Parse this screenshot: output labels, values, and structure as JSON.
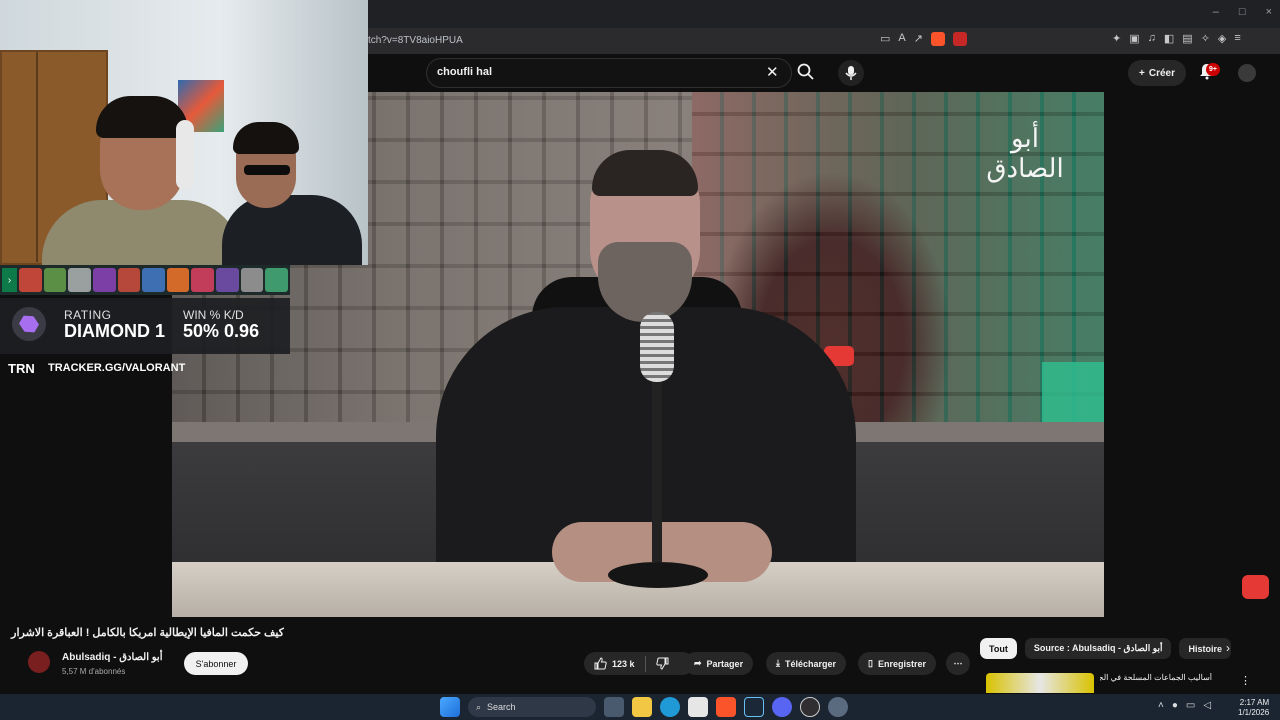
{
  "browser": {
    "url": "tch?v=8TV8aioHPUA",
    "window_controls": [
      "–",
      "□",
      "×"
    ]
  },
  "youtube_header": {
    "search_query": "choufli hal",
    "create_label": "Créer",
    "notification_badge": "9+"
  },
  "video": {
    "channel_logo_text": "أبو الصادق"
  },
  "overlay": {
    "rating_label": "RATING",
    "rating_value": "DIAMOND 1",
    "win_label": "WIN %",
    "kd_label": "K/D",
    "win_value": "50%",
    "kd_value": "0.96",
    "trn_logo": "TRN",
    "tracker_url": "TRACKER.GG/VALORANT",
    "agent_colors": [
      "#c0463a",
      "#5a8f45",
      "#9aa0a0",
      "#7b3fa6",
      "#b5483a",
      "#3e6fb2",
      "#d46a2a",
      "#c23d5a",
      "#6a4a9e",
      "#8c8c8c",
      "#3f9b6e"
    ]
  },
  "video_info": {
    "title": "كيف حكمت المافيا الإيطالية امريكا بالكامل ! العباقرة الاشرار",
    "channel_name": "Abulsadiq - أبو الصادق",
    "subscribers": "5,57 M d'abonnés",
    "subscribe_label": "S'abonner",
    "likes": "123 k",
    "share_label": "Partager",
    "download_label": "Télécharger",
    "save_label": "Enregistrer"
  },
  "chips": [
    {
      "label": "Tout",
      "active": true
    },
    {
      "label": "Source : Abulsadiq - أبو الصادق",
      "active": false
    },
    {
      "label": "Histoire",
      "active": false
    }
  ],
  "recommendation": {
    "title": "أساليب الجماعات المسلحة في الجزر الخالية"
  },
  "taskbar": {
    "search_label": "Search",
    "time": "2:17 AM",
    "date": "1/1/2026"
  },
  "colors": {
    "background": "#0f0f0f",
    "accent_red": "#cc0000",
    "rank_purple": "#a86ef0"
  }
}
